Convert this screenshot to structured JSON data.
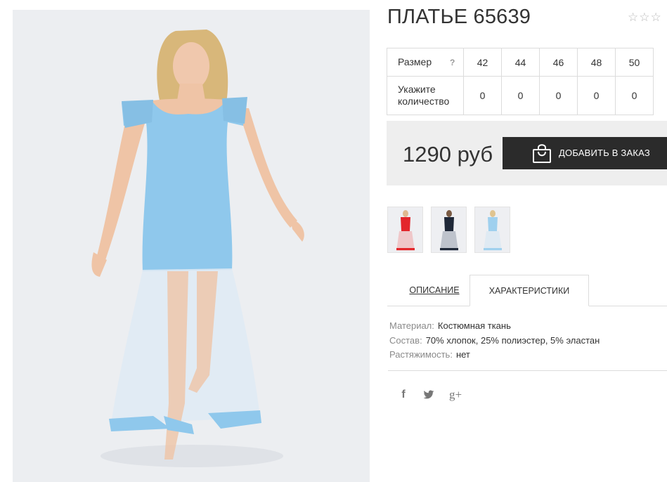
{
  "product": {
    "title": "ПЛАТЬЕ 65639",
    "rating_stars": "☆☆☆"
  },
  "size_table": {
    "size_label": "Размер",
    "help_icon_text": "?",
    "sizes": [
      "42",
      "44",
      "46",
      "48",
      "50"
    ],
    "quantity_label": "Укажите количество",
    "quantities": [
      "0",
      "0",
      "0",
      "0",
      "0"
    ]
  },
  "price": {
    "value": "1290 руб",
    "order_button_label": "ДОБАВИТЬ В ЗАКАЗ"
  },
  "thumbnails": [
    {
      "name": "red-dress",
      "color": "#e3262b"
    },
    {
      "name": "navy-dress",
      "color": "#1f2838"
    },
    {
      "name": "blue-dress",
      "color": "#9fd0ee"
    }
  ],
  "tabs": {
    "description": "ОПИСАНИЕ",
    "characteristics": "ХАРАКТЕРИСТИКИ"
  },
  "specs": [
    {
      "key": "Материал:",
      "value": "Костюмная ткань"
    },
    {
      "key": "Состав:",
      "value": "70% хлопок, 25% полиэстер, 5% эластан"
    },
    {
      "key": "Растяжимость:",
      "value": "нет"
    }
  ],
  "social": {
    "facebook": "f",
    "twitter": "twitter-icon",
    "google_plus": "g+"
  },
  "colors": {
    "button_bg": "#2b2b2b",
    "price_box_bg": "#eeeeee",
    "dress_blue": "#8ec8ec"
  }
}
